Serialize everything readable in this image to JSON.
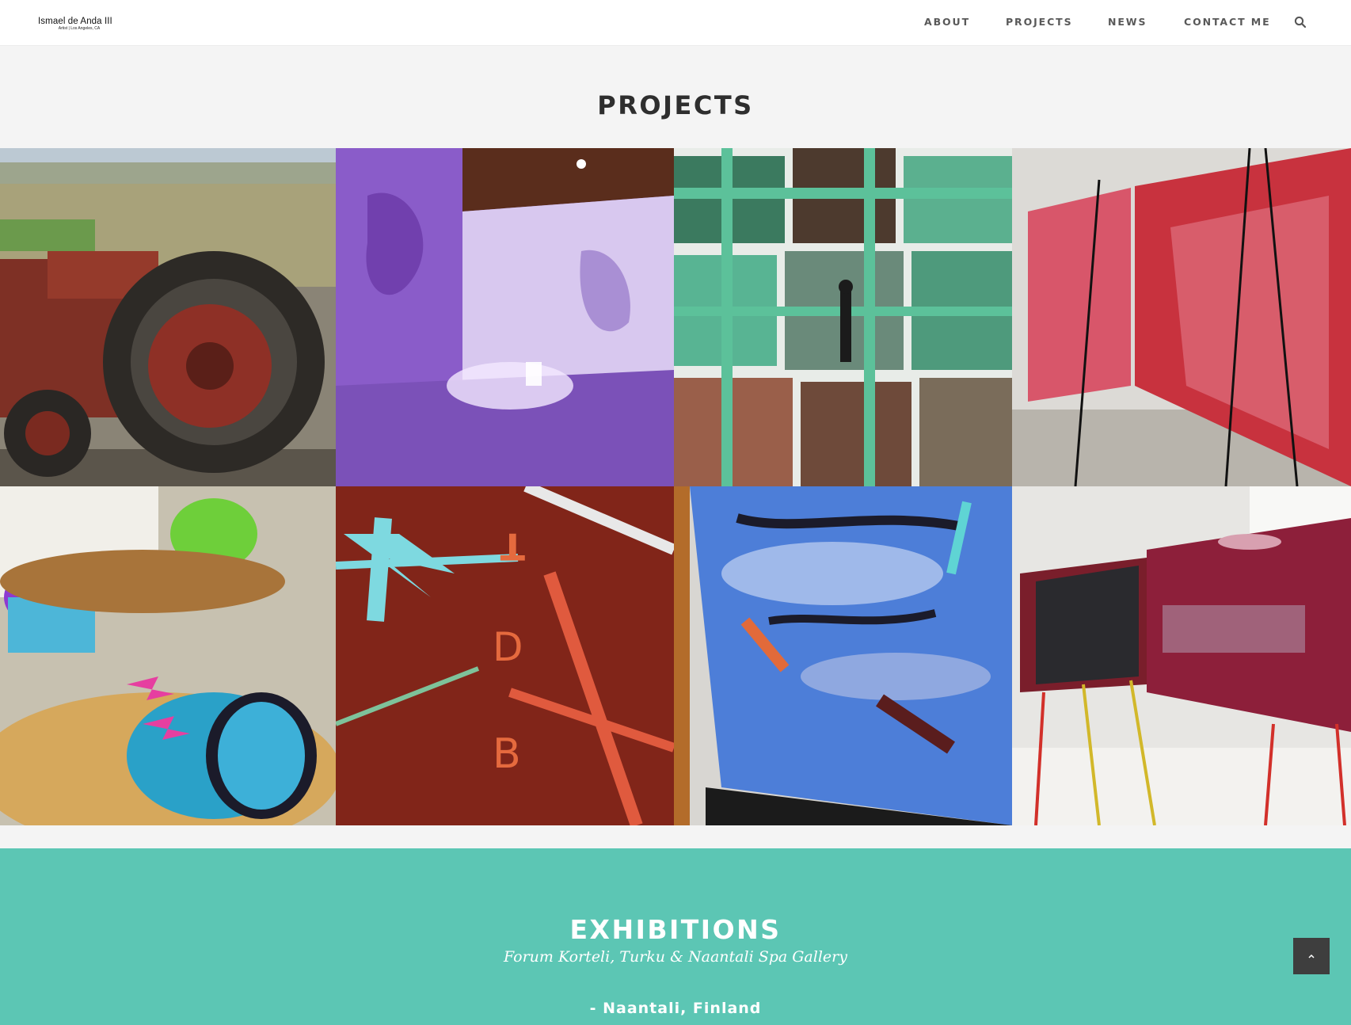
{
  "header": {
    "logo_name": "Ismael de Anda III",
    "logo_sub": "Artist | Los Angeles, CA",
    "nav": [
      "ABOUT",
      "PROJECTS",
      "NEWS",
      "CONTACT ME"
    ],
    "search_icon": "search-icon"
  },
  "projects": {
    "title": "PROJECTS",
    "tiles": [
      {
        "alt": "rusted red tractor in desert landscape"
      },
      {
        "alt": "purple lit gallery installation with shadows"
      },
      {
        "alt": "grid of photographs with green tape and digital marks"
      },
      {
        "alt": "red abstract prints on easels"
      },
      {
        "alt": "painted drum kit with lightning bolts"
      },
      {
        "alt": "red textured image with cyan feather shapes"
      },
      {
        "alt": "blue water reflection on screen with marks"
      },
      {
        "alt": "prints on colored easels in bright room"
      }
    ]
  },
  "exhibitions": {
    "title": "EXHIBITIONS",
    "subtitle": "Forum Korteli, Turku & Naantali Spa Gallery",
    "location": "- Naantali, Finland"
  },
  "scroll_top_icon": "chevron-up-icon",
  "colors": {
    "accent_teal": "#5cc6b4",
    "header_bg": "#ffffff",
    "page_bg": "#f4f4f4",
    "nav_text": "#595959"
  }
}
